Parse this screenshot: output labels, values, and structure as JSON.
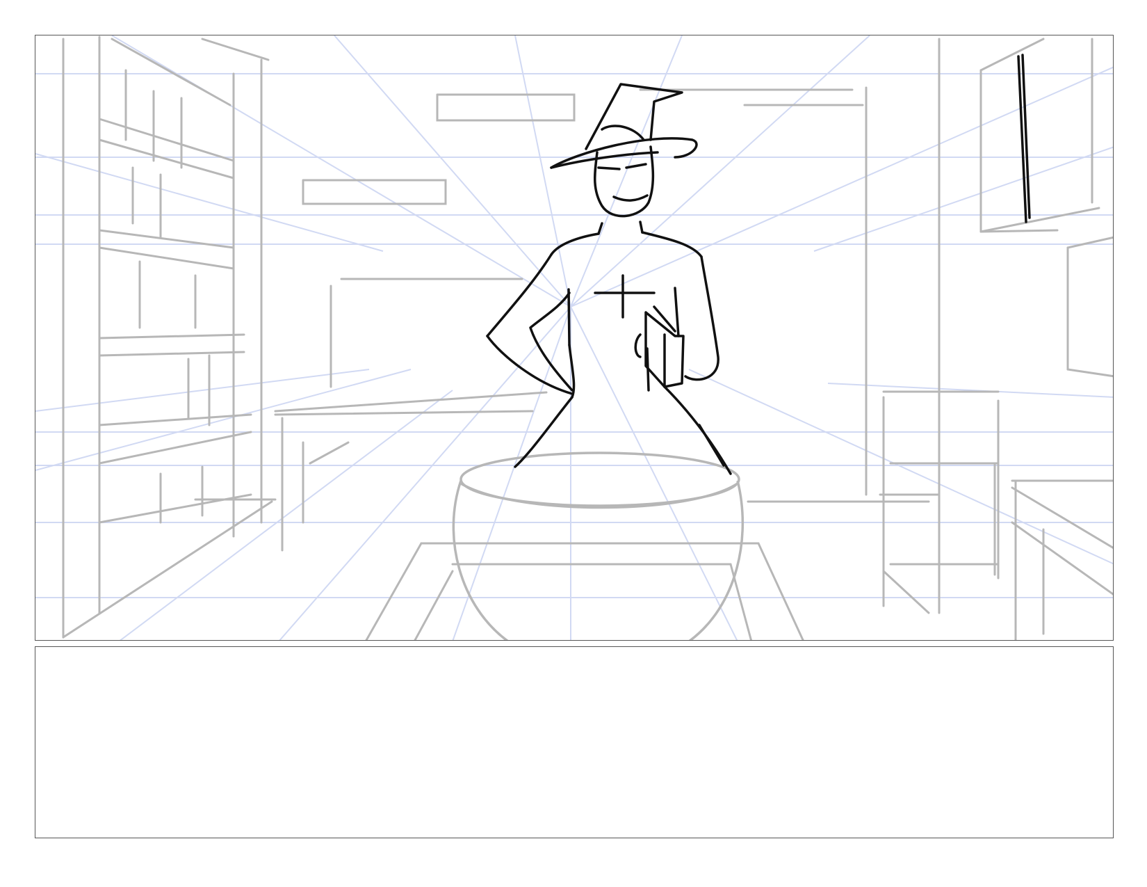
{
  "storyboard": {
    "frame": {
      "icon": "storyboard-sketch-witch-with-cauldron",
      "guide_color": "#c9d3f1",
      "background_color": "#b7b7b7",
      "figure_color": "#111111"
    },
    "caption": {
      "text": ""
    }
  }
}
